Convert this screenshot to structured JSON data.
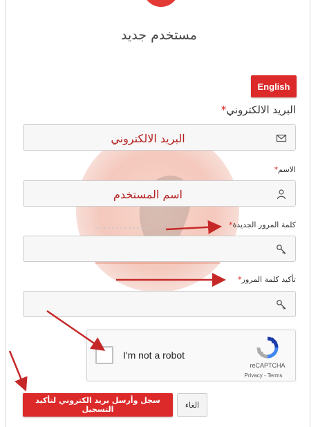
{
  "header": {
    "title": "مستخدم جديد",
    "language_button": "English"
  },
  "form": {
    "email": {
      "label": "البريد الالكتروني",
      "value": "البريد الالكتروني",
      "icon": "envelope-icon"
    },
    "name": {
      "label": "الاسم",
      "value": "اسم المستخدم",
      "icon": "user-icon"
    },
    "new_password": {
      "label": "كلمة المرور الجديدة",
      "value": "",
      "icon": "key-icon"
    },
    "confirm_password": {
      "label": "تأكيد كلمة المرور",
      "value": "",
      "icon": "key-icon"
    },
    "required_mark": "*"
  },
  "captcha": {
    "label": "I'm not a robot",
    "brand": "reCAPTCHA",
    "links": "Privacy - Terms",
    "checked": false
  },
  "actions": {
    "cancel_label": "الغاء",
    "submit_label": "سجل وأرسل بريد الكتروني لتأكيد التسجيل"
  },
  "colors": {
    "accent": "#dc2a2a",
    "annotation_arrow": "#c62828"
  }
}
